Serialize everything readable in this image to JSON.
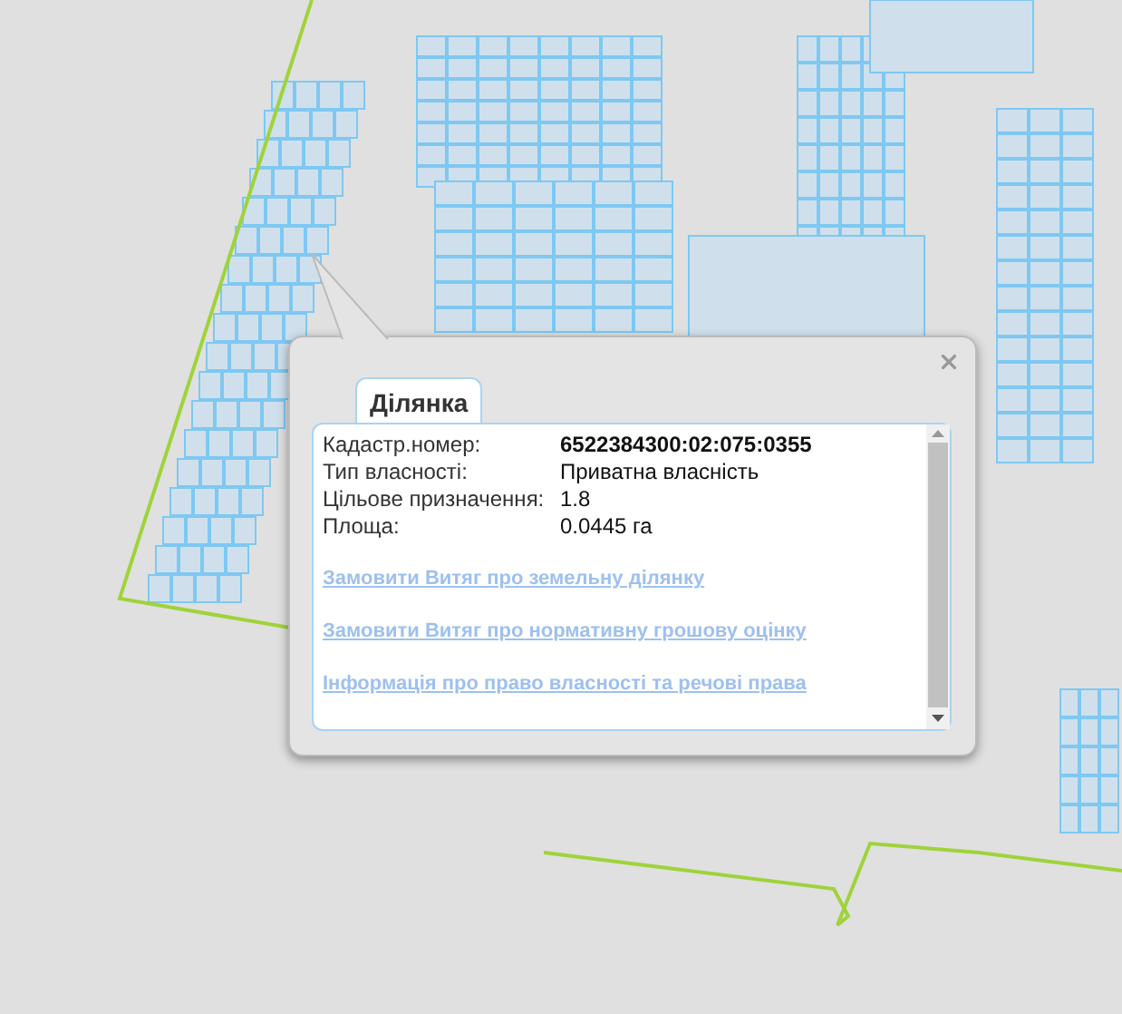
{
  "popup": {
    "tabs": [
      {
        "label": "Ділянка",
        "selected": true
      }
    ],
    "fields": [
      {
        "label": "Кадастр.номер:",
        "value": "6522384300:02:075:0355",
        "bold": true
      },
      {
        "label": "Тип власності:",
        "value": "Приватна власність",
        "bold": false
      },
      {
        "label": "Цільове призначення:",
        "value": "1.8",
        "bold": false
      },
      {
        "label": "Площа:",
        "value": "0.0445 га",
        "bold": false
      }
    ],
    "links": [
      "Замовити Витяг про земельну ділянку",
      "Замовити Витяг про нормативну грошову оцінку",
      "Інформація про право власності та речові права"
    ]
  }
}
